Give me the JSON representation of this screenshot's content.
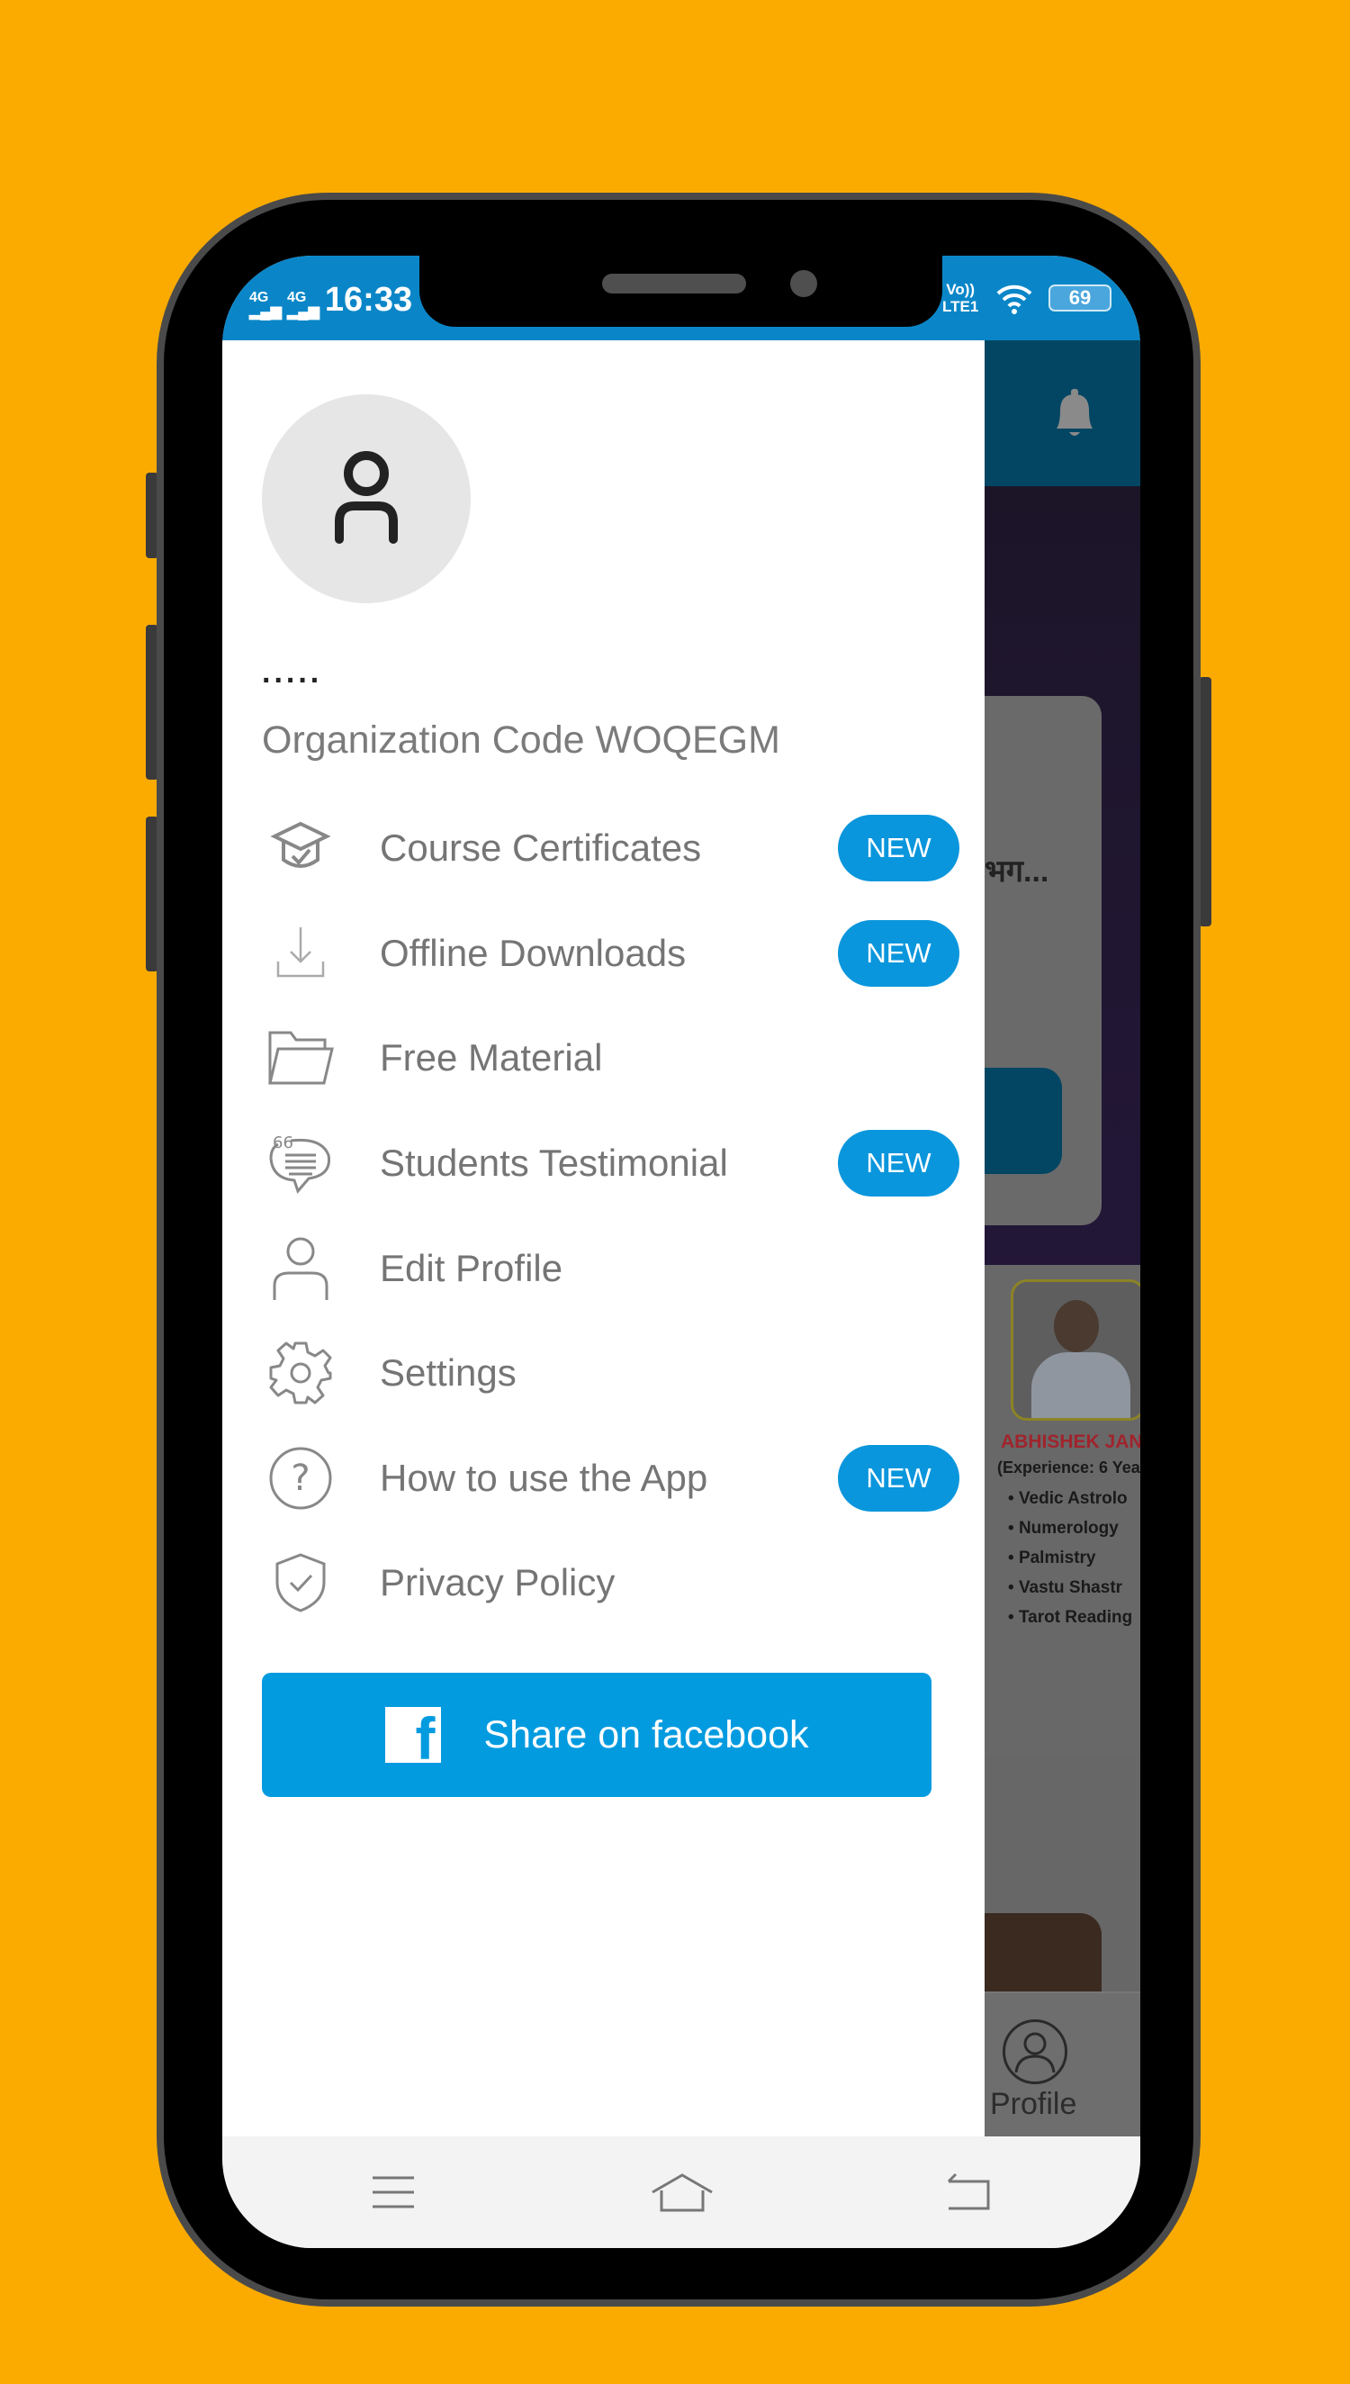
{
  "status_bar": {
    "network1": "4G",
    "network2": "4G",
    "time": "16:33",
    "volte": "Vo))",
    "lte": "LTE1",
    "battery": "69"
  },
  "background_app": {
    "card_text": "भग...",
    "teacher_name": "ABHISHEK JANG",
    "experience": "(Experience: 6 Yea",
    "skills": [
      "Vedic Astrolo",
      "Numerology",
      "Palmistry",
      "Vastu Shastr",
      "Tarot Reading"
    ],
    "nav_profile": "Profile"
  },
  "drawer": {
    "user_name": ".....",
    "org_code": "Organization Code WOQEGM",
    "items": [
      {
        "label": "Course Certificates",
        "icon": "graduation-cap-icon",
        "badge": "NEW"
      },
      {
        "label": "Offline Downloads",
        "icon": "download-icon",
        "badge": "NEW"
      },
      {
        "label": "Free Material",
        "icon": "folder-icon"
      },
      {
        "label": "Students Testimonial",
        "icon": "quote-chat-icon",
        "badge": "NEW"
      },
      {
        "label": "Edit Profile",
        "icon": "person-icon"
      },
      {
        "label": "Settings",
        "icon": "gear-icon"
      },
      {
        "label": "How to use the App",
        "icon": "help-icon",
        "badge": "NEW"
      },
      {
        "label": "Privacy Policy",
        "icon": "shield-check-icon"
      }
    ],
    "share_label": "Share on facebook"
  },
  "colors": {
    "background": "#fbab00",
    "status_bar": "#0a86c8",
    "accent": "#0a96dc",
    "share_button": "#039be0"
  }
}
